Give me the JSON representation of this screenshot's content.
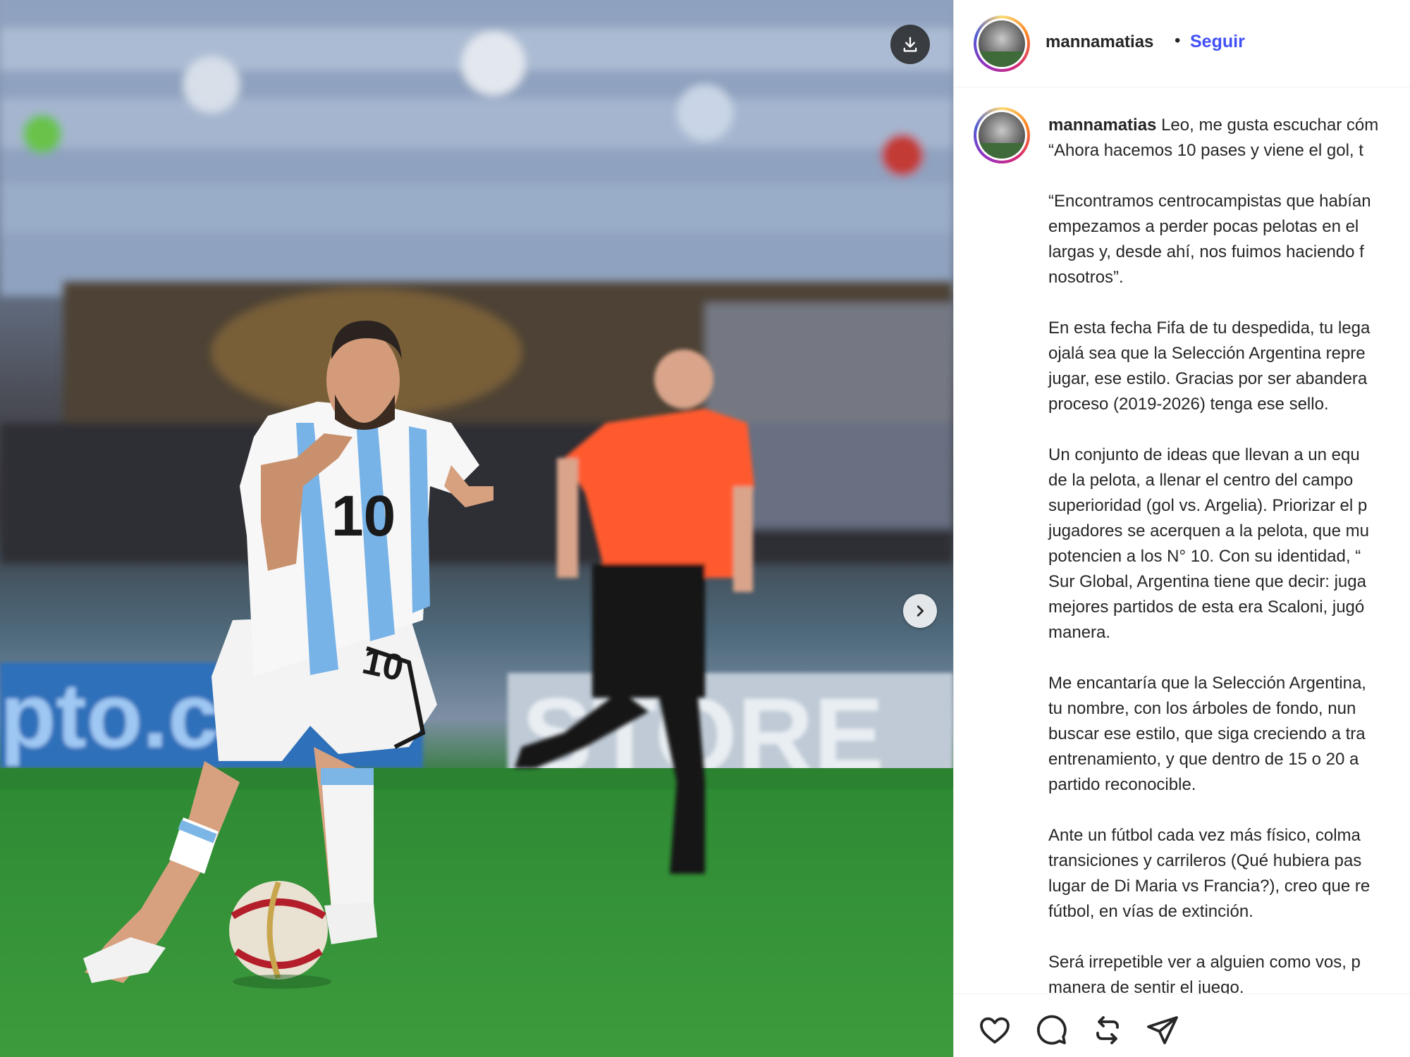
{
  "post": {
    "username": "mannamatias",
    "separator": "•",
    "follow_label": "Seguir",
    "image_alt_icon_next": "chevron-right-icon",
    "image_alt_icon_download": "download-icon"
  },
  "caption": {
    "username": "mannamatias",
    "paragraphs": [
      "Leo, me gusta escuchar cóm",
      "“Ahora hacemos 10 pases y viene el gol, t",
      "“Encontramos centrocampistas que habían",
      "empezamos a perder pocas pelotas en el",
      "largas y, desde ahí, nos fuimos haciendo f",
      "nosotros”.",
      "En esta fecha Fifa de tu despedida, tu lega",
      "ojalá sea que la Selección Argentina repre",
      "jugar, ese estilo. Gracias por ser abandera",
      "proceso (2019-2026) tenga ese sello.",
      "Un conjunto de ideas que llevan a un equ",
      "de la pelota, a llenar el centro del campo",
      "superioridad (gol vs. Argelia). Priorizar el p",
      "jugadores se acerquen a la pelota, que mu",
      "potencien a los N° 10. Con su identidad, “",
      "Sur Global, Argentina tiene que decir: juga",
      "mejores partidos de esta era Scaloni, jugó",
      "manera.",
      "Me encantaría que la Selección Argentina,",
      "tu nombre, con los árboles de fondo, nun",
      "buscar ese estilo, que siga creciendo a tra",
      "entrenamiento, y que dentro de 15 o 20 a",
      "partido reconocible.",
      "Ante un fútbol cada vez más físico, colma",
      "transiciones y carrileros (Qué hubiera pas",
      "lugar de Di Maria vs Francia?), creo que re",
      "fútbol, en vías de extinción.",
      "Será irrepetible ver a alguien como vos, p",
      "manera de sentir el juego."
    ]
  },
  "actions": {
    "like": "heart-icon",
    "comment": "comment-icon",
    "repost": "repost-icon",
    "share": "send-icon"
  },
  "photo": {
    "jersey_number": "10"
  },
  "colors": {
    "follow": "#4150f7",
    "text": "#262626",
    "divider": "#efefef"
  }
}
